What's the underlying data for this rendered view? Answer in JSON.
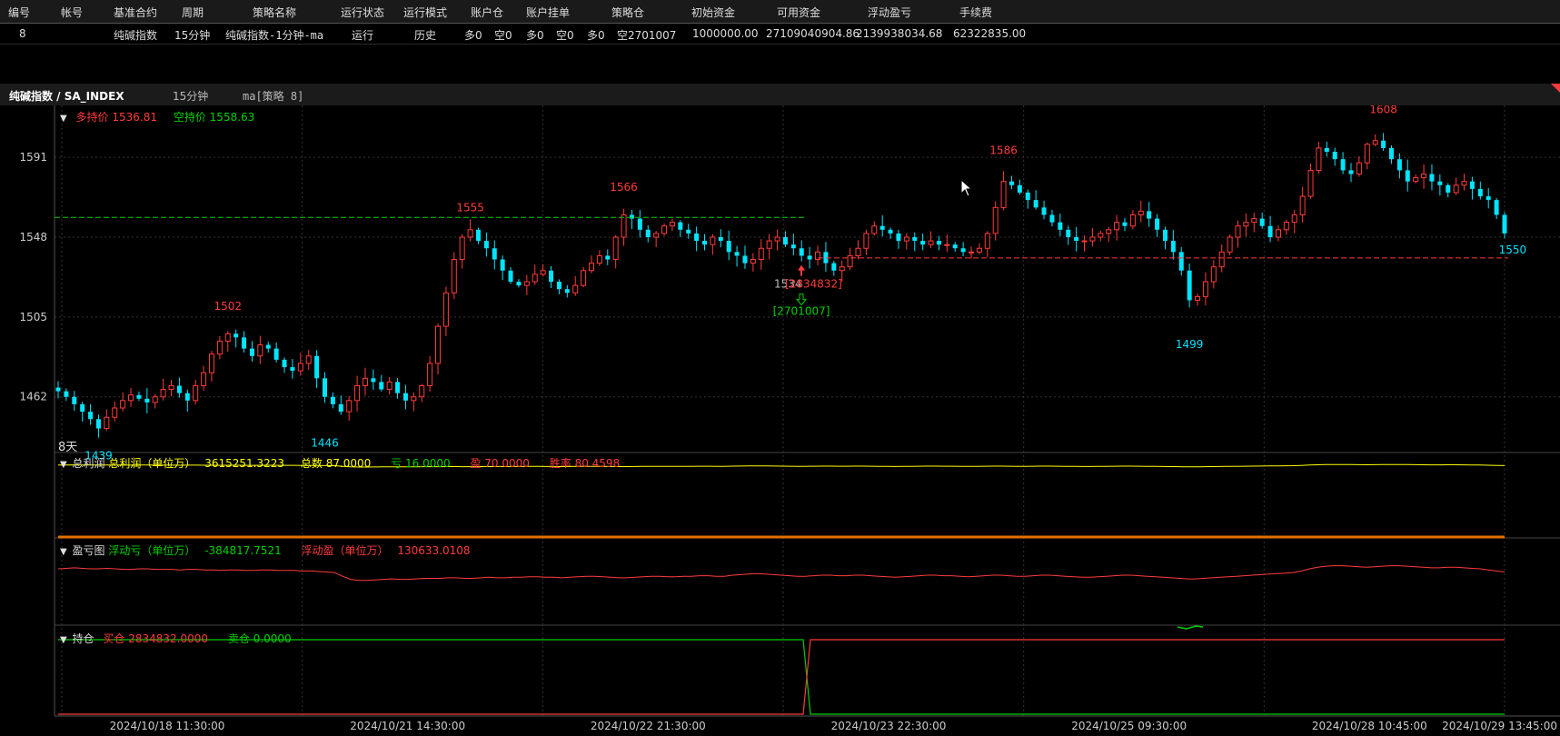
{
  "table": {
    "columns": [
      "编号",
      "帐号",
      "基准合约",
      "周期",
      "策略名称",
      "运行状态",
      "运行模式",
      "账户仓",
      "账户挂单",
      "策略仓",
      "初始资金",
      "可用资金",
      "浮动盈亏",
      "手续费"
    ],
    "row": {
      "id": "8",
      "account": "",
      "contract": "纯碱指数",
      "period": "15分钟",
      "strategy": "纯碱指数-1分钟-ma",
      "status": "运行",
      "mode": "历史",
      "acct_pos_long": "多0",
      "acct_pos_short": "空0",
      "acct_order_long": "多0",
      "acct_order_short": "空0",
      "strat_pos_long": "多0",
      "strat_pos_short": "空2701007",
      "init_capital": "1000000.00",
      "avail_capital": "27109040904.86",
      "float_pnl": "2139938034.68",
      "fee": "62322835.00"
    }
  },
  "chart_header": {
    "symbol": "纯碱指数 / SA_INDEX",
    "period": "15分钟",
    "strategy": "ma[策略 8]"
  },
  "panels": {
    "price": {
      "long_label": "多持价",
      "long_value": "1536.81",
      "short_label": "空持价",
      "short_value": "1558.63",
      "bottom_label": "8天"
    },
    "profit": {
      "title": "总利润",
      "l1": "总利润（单位万）",
      "v1": "3615251.3223",
      "l2": "总数",
      "v2": "87.0000",
      "l3": "亏",
      "v3": "16.0000",
      "l4": "盈",
      "v4": "70.0000",
      "l5": "胜率",
      "v5": "80.4598"
    },
    "pnl": {
      "title": "盈亏图",
      "l1": "浮动亏（单位万）",
      "v1": "-384817.7521",
      "l2": "浮动盈（单位万）",
      "v2": "130633.0108"
    },
    "position": {
      "title": "持仓",
      "l1": "买仓",
      "v1": "2834832.0000",
      "l2": "卖仓",
      "v2": "0.0000"
    }
  },
  "colors": {
    "up": "#ff3b3b",
    "down": "#00e5ff",
    "green": "#00d000",
    "yellow": "#ffff00",
    "orange": "#e07000"
  },
  "chart_data": {
    "type": "candlestick",
    "y_ticks": [
      1591,
      1548,
      1505,
      1462
    ],
    "x_labels": [
      "2024/10/18 11:30:00",
      "2024/10/21 14:30:00",
      "2024/10/22 21:30:00",
      "2024/10/23 22:30:00",
      "2024/10/25 09:30:00",
      "2024/10/28 10:45:00",
      "2024/10/29 13:45:00"
    ],
    "ylim": [
      1433,
      1617
    ],
    "price_labels": [
      {
        "text": "1439",
        "idx": 5,
        "value": 1439,
        "pos": "below",
        "kind": "low"
      },
      {
        "text": "1502",
        "idx": 21,
        "value": 1502,
        "pos": "above",
        "kind": "high"
      },
      {
        "text": "1446",
        "idx": 33,
        "value": 1446,
        "pos": "below",
        "kind": "low"
      },
      {
        "text": "1555",
        "idx": 51,
        "value": 1555,
        "pos": "above",
        "kind": "high"
      },
      {
        "text": "1566",
        "idx": 70,
        "value": 1566,
        "pos": "above",
        "kind": "high"
      },
      {
        "text": "1586",
        "idx": 117,
        "value": 1586,
        "pos": "above",
        "kind": "high"
      },
      {
        "text": "1499",
        "idx": 140,
        "value": 1499,
        "pos": "below",
        "kind": "low"
      },
      {
        "text": "1608",
        "idx": 164,
        "value": 1608,
        "pos": "above",
        "kind": "high"
      },
      {
        "text": "1550",
        "idx": 180,
        "value": 1550,
        "pos": "below",
        "kind": "low"
      }
    ],
    "long_hold_price": 1536.81,
    "short_hold_price": 1558.63,
    "trade_labels": [
      {
        "text": "1534",
        "value": 1534
      },
      {
        "text": "[2834832]",
        "value": 1534
      },
      {
        "text": "[2701007]",
        "value": 1534
      }
    ],
    "closes": [
      1465,
      1462,
      1458,
      1454,
      1450,
      1445,
      1451,
      1456,
      1460,
      1463,
      1461,
      1459,
      1462,
      1466,
      1468,
      1464,
      1460,
      1468,
      1475,
      1485,
      1492,
      1496,
      1494,
      1488,
      1484,
      1490,
      1488,
      1482,
      1478,
      1476,
      1480,
      1484,
      1472,
      1462,
      1458,
      1454,
      1460,
      1468,
      1472,
      1470,
      1466,
      1470,
      1464,
      1460,
      1462,
      1468,
      1480,
      1500,
      1518,
      1536,
      1548,
      1552,
      1546,
      1542,
      1536,
      1530,
      1524,
      1522,
      1524,
      1528,
      1530,
      1524,
      1520,
      1518,
      1522,
      1530,
      1534,
      1538,
      1536,
      1548,
      1560,
      1558,
      1552,
      1548,
      1550,
      1554,
      1556,
      1552,
      1550,
      1546,
      1544,
      1548,
      1546,
      1540,
      1538,
      1534,
      1536,
      1542,
      1546,
      1548,
      1544,
      1542,
      1538,
      1536,
      1540,
      1534,
      1530,
      1532,
      1538,
      1542,
      1550,
      1554,
      1552,
      1550,
      1546,
      1548,
      1546,
      1544,
      1546,
      1544,
      1544,
      1542,
      1540,
      1540,
      1542,
      1550,
      1564,
      1578,
      1576,
      1572,
      1568,
      1564,
      1560,
      1556,
      1552,
      1548,
      1546,
      1546,
      1548,
      1550,
      1552,
      1556,
      1554,
      1560,
      1562,
      1558,
      1552,
      1546,
      1540,
      1530,
      1514,
      1516,
      1524,
      1532,
      1540,
      1548,
      1554,
      1556,
      1558,
      1554,
      1548,
      1552,
      1556,
      1560,
      1570,
      1584,
      1596,
      1594,
      1590,
      1584,
      1582,
      1588,
      1598,
      1600,
      1596,
      1590,
      1584,
      1578,
      1580,
      1582,
      1578,
      1576,
      1572,
      1576,
      1578,
      1574,
      1570,
      1568,
      1560,
      1550
    ],
    "profit_series": [
      0.38,
      0.37,
      0.36,
      0.37,
      0.38,
      0.38,
      0.37,
      0.38,
      0.39,
      0.39,
      0.38,
      0.38,
      0.39,
      0.39,
      0.39,
      0.4,
      0.39,
      0.39,
      0.4,
      0.4,
      0.41,
      0.4,
      0.4,
      0.41,
      0.41,
      0.4,
      0.4,
      0.41,
      0.41,
      0.41,
      0.42,
      0.42,
      0.43,
      0.44,
      0.45,
      0.52,
      0.58,
      0.6,
      0.6,
      0.59,
      0.58,
      0.57,
      0.58,
      0.58,
      0.57,
      0.56,
      0.56,
      0.56,
      0.55,
      0.55,
      0.56,
      0.56,
      0.55,
      0.54,
      0.55,
      0.55,
      0.54,
      0.54,
      0.53,
      0.53,
      0.54,
      0.54,
      0.55,
      0.54,
      0.53,
      0.52,
      0.52,
      0.53,
      0.54,
      0.55,
      0.55,
      0.54,
      0.53,
      0.52,
      0.52,
      0.53,
      0.53,
      0.52,
      0.52,
      0.51,
      0.51,
      0.52,
      0.52,
      0.5,
      0.49,
      0.48,
      0.47,
      0.48,
      0.49,
      0.5,
      0.51,
      0.52,
      0.52,
      0.51,
      0.5,
      0.5,
      0.51,
      0.51,
      0.5,
      0.5,
      0.51,
      0.52,
      0.53,
      0.54,
      0.53,
      0.52,
      0.51,
      0.5,
      0.5,
      0.51,
      0.51,
      0.52,
      0.53,
      0.52,
      0.51,
      0.5,
      0.5,
      0.51,
      0.52,
      0.52,
      0.51,
      0.5,
      0.5,
      0.51,
      0.52,
      0.53,
      0.54,
      0.54,
      0.53,
      0.52,
      0.51,
      0.5,
      0.5,
      0.51,
      0.52,
      0.53,
      0.54,
      0.55,
      0.56,
      0.57,
      0.57,
      0.56,
      0.55,
      0.54,
      0.53,
      0.52,
      0.51,
      0.5,
      0.49,
      0.48,
      0.47,
      0.46,
      0.45,
      0.42,
      0.38,
      0.35,
      0.33,
      0.32,
      0.32,
      0.33,
      0.34,
      0.35,
      0.34,
      0.33,
      0.32,
      0.32,
      0.33,
      0.34,
      0.35,
      0.36,
      0.36,
      0.35,
      0.35,
      0.36,
      0.37,
      0.38,
      0.4,
      0.42,
      0.44
    ]
  }
}
